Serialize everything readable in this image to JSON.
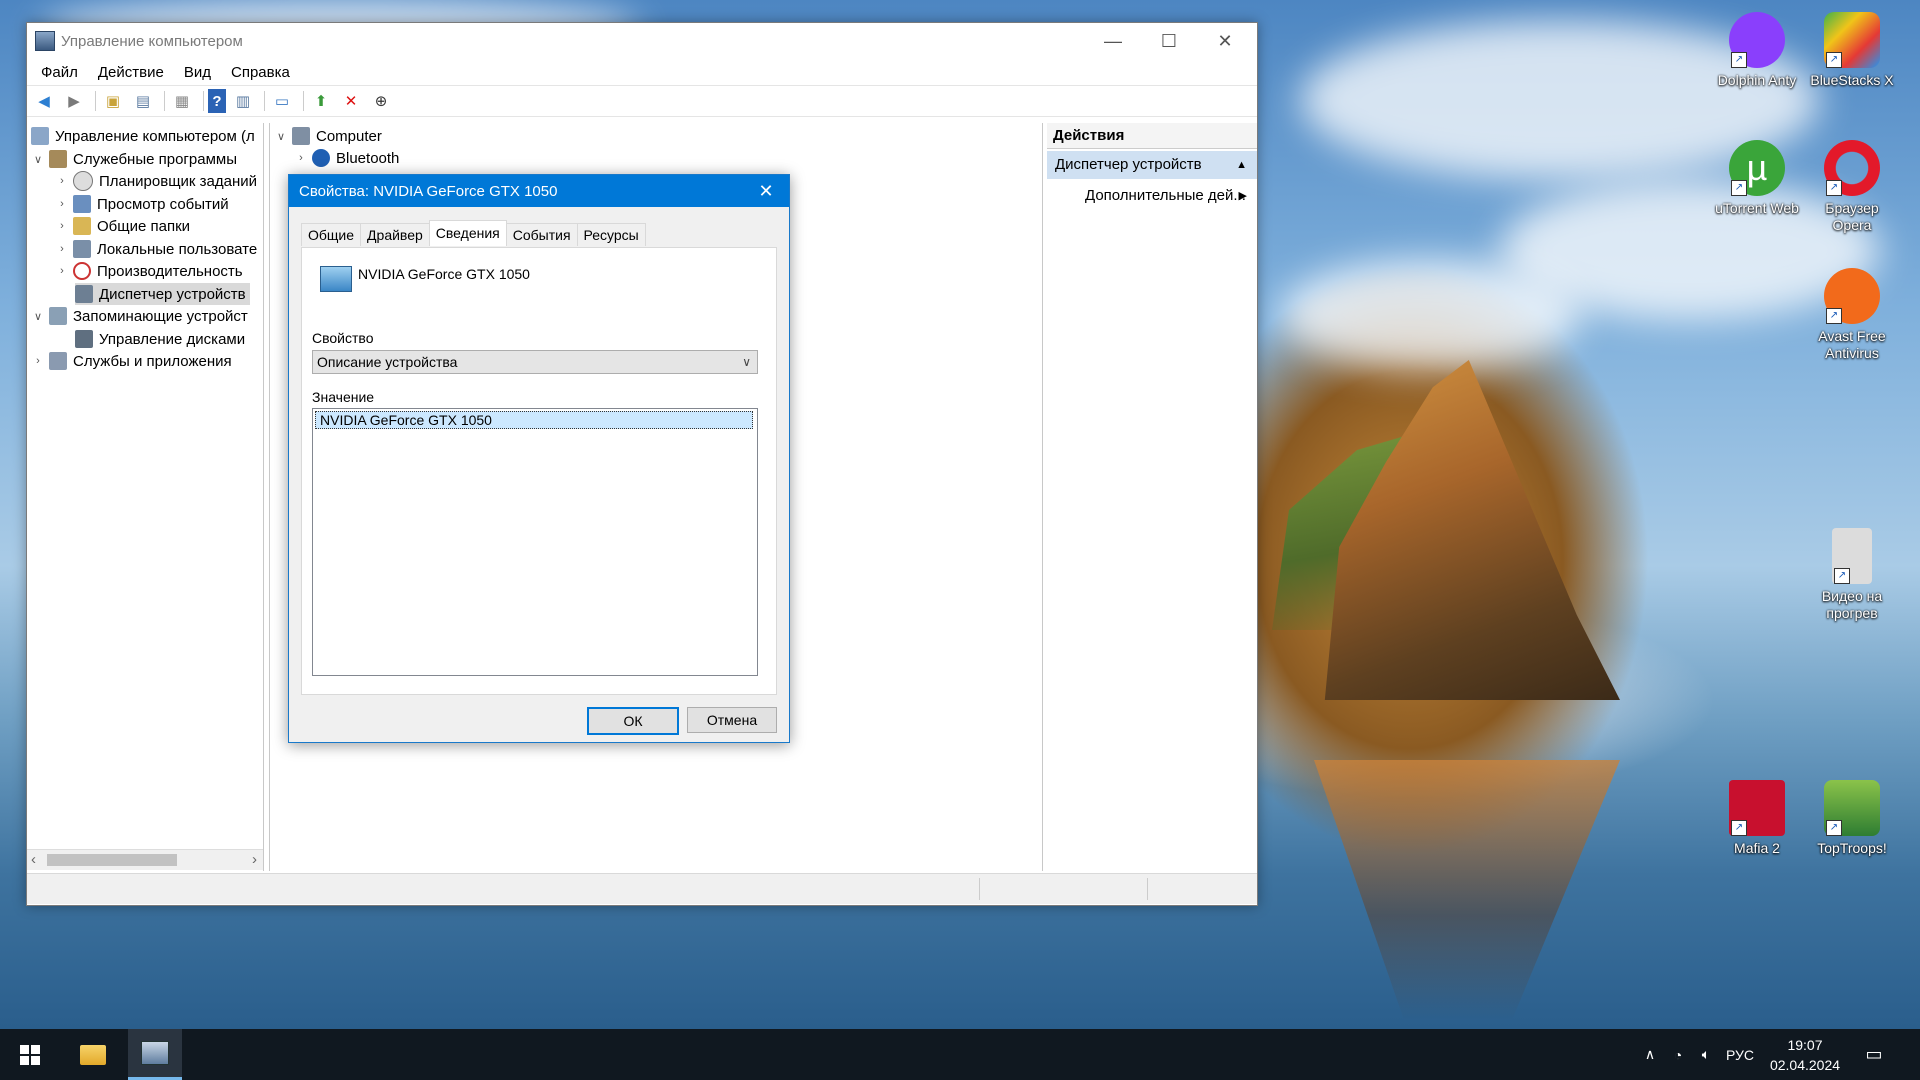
{
  "window": {
    "title": "Управление компьютером",
    "menu": [
      "Файл",
      "Действие",
      "Вид",
      "Справка"
    ]
  },
  "tree": {
    "root": "Управление компьютером (л",
    "items": [
      "Служебные программы",
      "Планировщик заданий",
      "Просмотр событий",
      "Общие папки",
      "Локальные пользовате",
      "Производительность",
      "Диспетчер устройств",
      "Запоминающие устройст",
      "Управление дисками",
      "Службы и приложения"
    ]
  },
  "devices": {
    "computer": "Computer",
    "bluetooth": "Bluetooth"
  },
  "actions": {
    "header": "Действия",
    "section": "Диспетчер устройств",
    "more": "Дополнительные дей..."
  },
  "dialog": {
    "title": "Свойства: NVIDIA GeForce GTX 1050",
    "tabs": [
      "Общие",
      "Драйвер",
      "Сведения",
      "События",
      "Ресурсы"
    ],
    "device_name": "NVIDIA GeForce GTX 1050",
    "property_label": "Свойство",
    "property_value": "Описание устройства",
    "value_label": "Значение",
    "value_item": "NVIDIA GeForce GTX 1050",
    "ok": "ОК",
    "cancel": "Отмена"
  },
  "desktop_icons": [
    {
      "label": "Dolphin Anty",
      "color": "#8a3ffc"
    },
    {
      "label": "BlueStacks X",
      "color": "#3fb24a"
    },
    {
      "label": "uTorrent Web",
      "color": "#3aa53a"
    },
    {
      "label": "Браузер Opera",
      "color": "#e3192a"
    },
    {
      "label": "Avast Free Antivirus",
      "color": "#f26a1b"
    },
    {
      "label": "Видео на прогрев",
      "color": "#c9c9c9"
    },
    {
      "label": "Mafia 2",
      "color": "#c8102e"
    },
    {
      "label": "TopTroops!",
      "color": "#4caf50"
    }
  ],
  "taskbar": {
    "lang": "РУС",
    "time": "19:07",
    "date": "02.04.2024"
  }
}
